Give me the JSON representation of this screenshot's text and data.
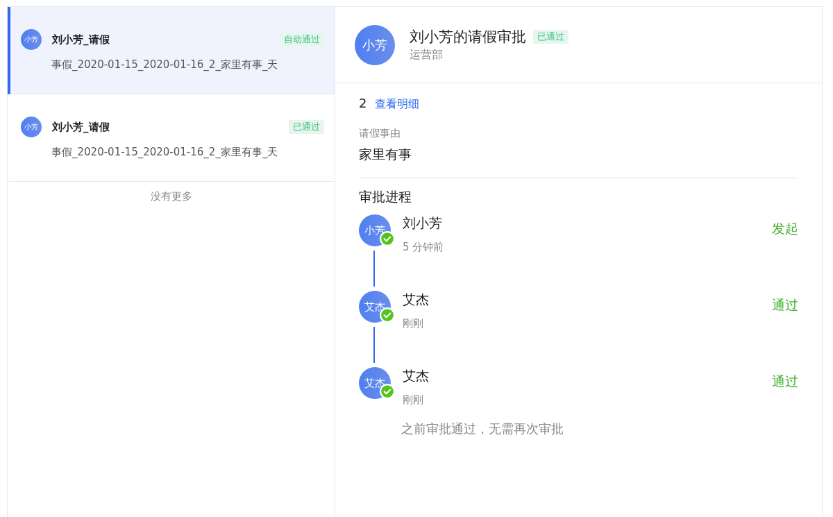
{
  "requests": [
    {
      "avatar": "小芳",
      "title": "刘小芳_请假",
      "status": "自动通过",
      "summary": "事假_2020-01-15_2020-01-16_2_家里有事_天",
      "selected": true
    },
    {
      "avatar": "小芳",
      "title": "刘小芳_请假",
      "status": "已通过",
      "summary": "事假_2020-01-15_2020-01-16_2_家里有事_天",
      "selected": false
    }
  ],
  "list_end": "没有更多",
  "detail": {
    "avatar": "小芳",
    "title": "刘小芳的请假审批",
    "status": "已通过",
    "department": "运营部",
    "duration": {
      "value": "2",
      "link": "查看明细"
    },
    "reason": {
      "label": "请假事由",
      "value": "家里有事"
    },
    "process": {
      "title": "审批进程",
      "steps": [
        {
          "avatar": "小芳",
          "name": "刘小芳",
          "time": "5 分钟前",
          "action": "发起",
          "done": true
        },
        {
          "avatar": "艾杰",
          "name": "艾杰",
          "time": "刚刚",
          "action": "通过",
          "done": true
        },
        {
          "avatar": "艾杰",
          "name": "艾杰",
          "time": "刚刚",
          "action": "通过",
          "done": true,
          "note": "之前审批通过，无需再次审批"
        }
      ]
    }
  }
}
